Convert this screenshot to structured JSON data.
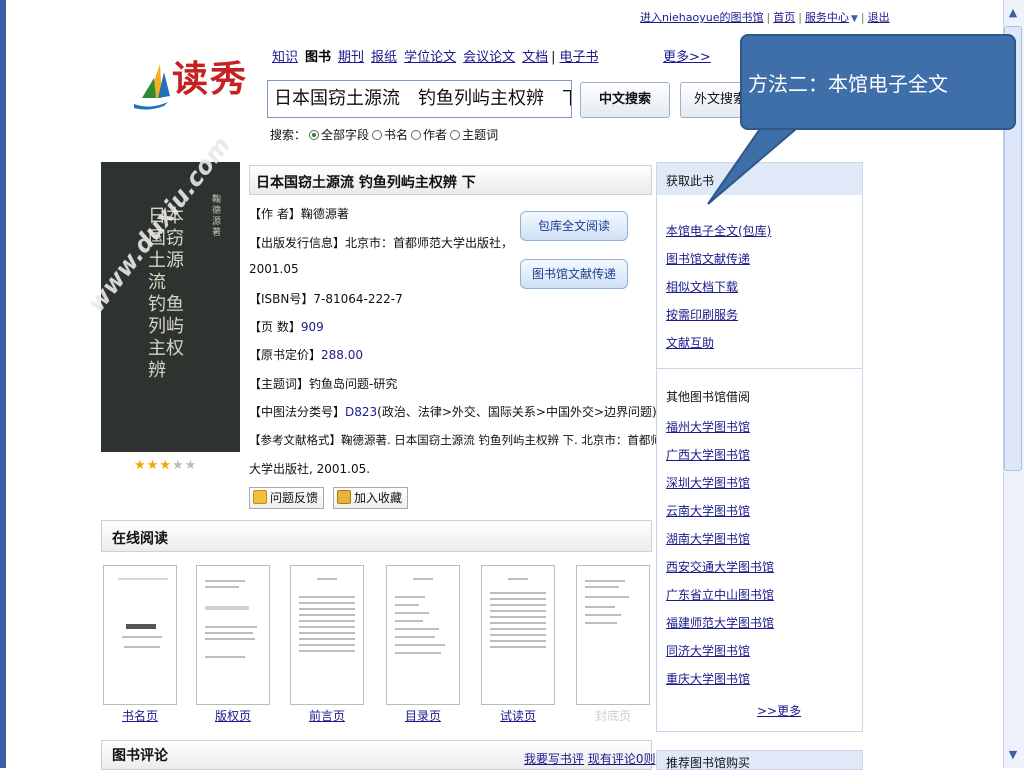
{
  "top_links": {
    "user_library": "进入niehaoyue的图书馆",
    "home": "首页",
    "service_center": "服务中心",
    "logout": "退出"
  },
  "logo": {
    "text": "读秀",
    "color": "#c62020"
  },
  "nav_tabs": [
    "知识",
    "图书",
    "期刊",
    "报纸",
    "学位论文",
    "会议论文",
    "文档",
    "电子书"
  ],
  "nav_separator": "|",
  "nav_more": "更多>>",
  "search": {
    "query": "日本国窃土源流　钓鱼列屿主权辨　下",
    "cn_button": "中文搜索",
    "foreign_button": "外文搜索",
    "scope_label": "搜索：",
    "scope_options": [
      "全部字段",
      "书名",
      "作者",
      "主题词"
    ],
    "scope_selected": "全部字段"
  },
  "callout": {
    "text": "方法二：本馆电子全文",
    "color": "#3e6fa8"
  },
  "book": {
    "title": "日本国窃土源流 钓鱼列屿主权辨 下",
    "cover_title": "日本国窃土源流 钓鱼列屿主权辨",
    "cover_author": "鞠德源 著",
    "watermark": "www.duxiu.com",
    "author_label": "【作 者】",
    "author_value": "鞠德源著",
    "pub_label": "【出版发行信息】",
    "pub_value_1": "北京市：首都师范大学出版社，",
    "pub_value_2": "2001.05",
    "isbn_label": "【ISBN号】",
    "isbn_value": "7-81064-222-7",
    "pages_label": "【页 数】",
    "pages_value": "909",
    "price_label": "【原书定价】",
    "price_value": "288.00",
    "subject_label": "【主题词】",
    "subject_value": "钓鱼岛问题-研究",
    "clc_label": "【中图法分类号】",
    "clc_value": "D823",
    "clc_desc": "(政治、法律>外交、国际关系>中国外交>边界问题)",
    "ref_label": "【参考文献格式】",
    "ref_value_1": "鞠德源著. 日本国窃土源流 钓鱼列屿主权辨 下. 北京市：首都师范",
    "ref_value_2": "大学出版社, 2001.05.",
    "rating_stars": 3,
    "rating_max": 5,
    "btn_read_full": "包库全文阅读",
    "btn_doc_delivery": "图书馆文献传递",
    "btn_feedback": "问题反馈",
    "btn_favorite": "加入收藏"
  },
  "right_panel": {
    "get_title": "获取此书",
    "get_links": [
      "本馆电子全文(包库)",
      "图书馆文献传递",
      "相似文档下载",
      "按需印刷服务",
      "文献互助"
    ],
    "other_title": "其他图书馆借阅",
    "libraries": [
      "福州大学图书馆",
      "广西大学图书馆",
      "深圳大学图书馆",
      "云南大学图书馆",
      "湖南大学图书馆",
      "西安交通大学图书馆",
      "广东省立中山图书馆",
      "福建师范大学图书馆",
      "同济大学图书馆",
      "重庆大学图书馆"
    ],
    "more": ">>更多",
    "bottom_title": "推荐图书馆购买"
  },
  "online_reading": {
    "title": "在线阅读",
    "pages": [
      "书名页",
      "版权页",
      "前言页",
      "目录页",
      "试读页",
      "封底页"
    ]
  },
  "reviews": {
    "title": "图书评论",
    "write": "我要写书评",
    "existing": "现有评论0则"
  }
}
